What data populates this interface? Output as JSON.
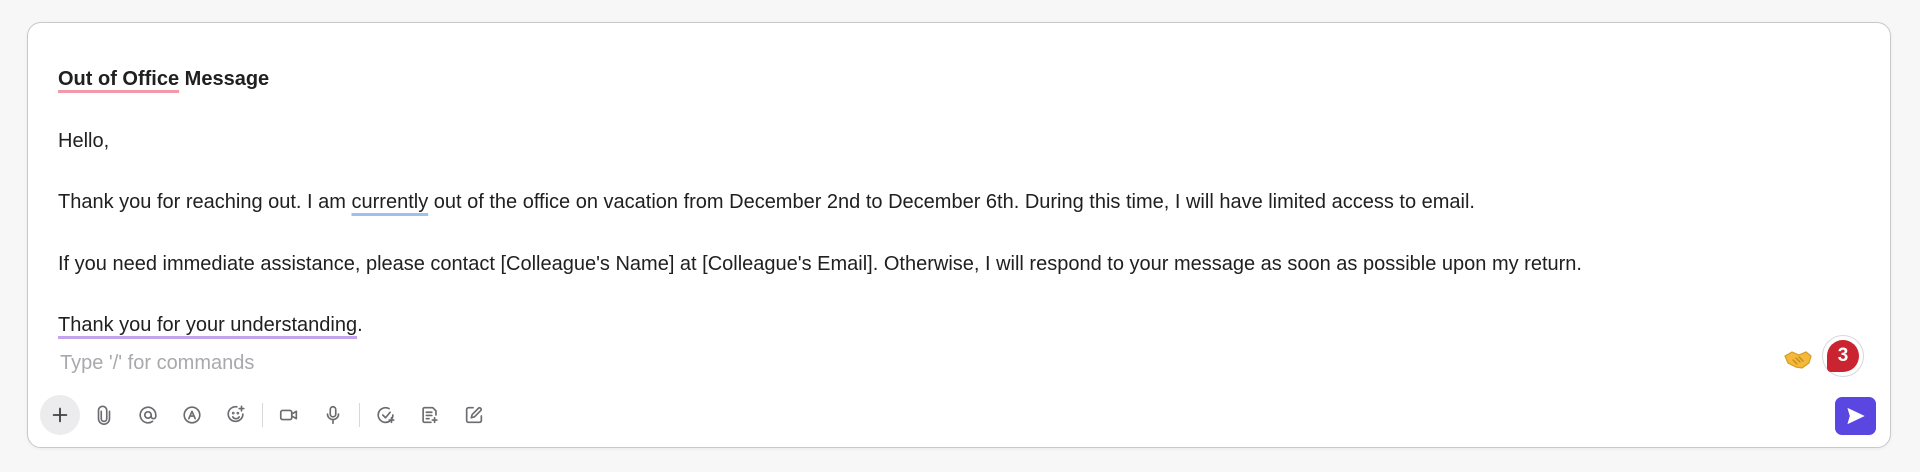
{
  "message": {
    "title_part1": "Out of Office",
    "title_part2": " Message",
    "greeting": "Hello,",
    "para1_before": "Thank you for reaching out. I am ",
    "para1_highlight": "currently",
    "para1_after": " out of the office on vacation from December 2nd to December 6th. During this time, I will have limited access to email.",
    "para2": "If you need immediate assistance, please contact [Colleague's Name] at [Colleague's Email]. Otherwise, I will respond to your message as soon as possible upon my return.",
    "closing_highlight": "Thank you for your understanding",
    "closing_end": "."
  },
  "input": {
    "placeholder": "Type '/' for commands",
    "value": ""
  },
  "reactions": {
    "emoji": "handshake-emoji",
    "badge_count": "3",
    "badge_color": "#c9242f"
  },
  "toolbar": {
    "icons": [
      "plus-icon",
      "paperclip-icon",
      "at-mention-icon",
      "assign-icon",
      "emoji-icon",
      "video-icon",
      "microphone-icon",
      "task-check-icon",
      "document-icon",
      "edit-create-icon"
    ]
  },
  "colors": {
    "send_button": "#5a46e0",
    "spell_underline": "#f19aaa",
    "grammar_underline": "#9ec0ee",
    "style_underline": "#c3a3ec"
  }
}
